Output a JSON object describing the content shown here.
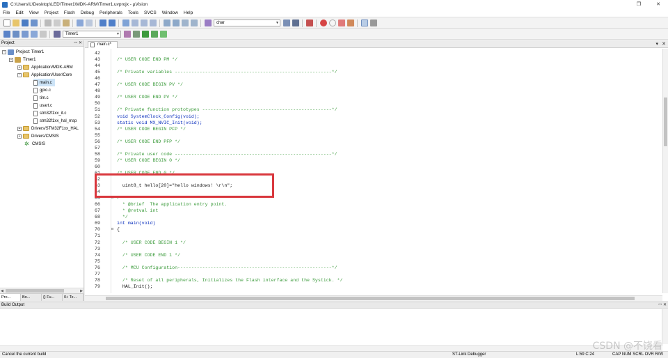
{
  "window": {
    "title": "C:\\Users\\L\\Desktop\\LED\\Timer1\\MDK-ARM\\Timer1.uvprojx - µVision"
  },
  "menu": [
    "File",
    "Edit",
    "View",
    "Project",
    "Flash",
    "Debug",
    "Peripherals",
    "Tools",
    "SVCS",
    "Window",
    "Help"
  ],
  "toolbar": {
    "search_value": "char",
    "target_value": "Timer1"
  },
  "project_panel": {
    "title": "Project",
    "root": "Project: Timer1",
    "target": "Timer1",
    "groups": [
      {
        "label": "Application/MDK-ARM",
        "expanded": false
      },
      {
        "label": "Application/User/Core",
        "expanded": true,
        "files": [
          "main.c",
          "gpio.c",
          "tim.c",
          "usart.c",
          "stm32f1xx_it.c",
          "stm32f1xx_hal_msp"
        ]
      },
      {
        "label": "Drivers/STM32F1xx_HAL",
        "expanded": false
      },
      {
        "label": "Drivers/CMSIS",
        "expanded": false
      }
    ],
    "cmsis": "CMSIS",
    "tabs": [
      "Pro...",
      "Bo...",
      "{} Fu...",
      "0+ Te..."
    ]
  },
  "editor": {
    "tab": "main.c*",
    "lines": [
      {
        "n": "42",
        "t": "",
        "c": "cm"
      },
      {
        "n": "43",
        "t": "/* USER CODE END PM */",
        "c": "cm"
      },
      {
        "n": "44",
        "t": "",
        "c": "cm"
      },
      {
        "n": "45",
        "t": "/* Private variables ---------------------------------------------------------*/",
        "c": "cm"
      },
      {
        "n": "46",
        "t": "",
        "c": "cm"
      },
      {
        "n": "47",
        "t": "/* USER CODE BEGIN PV */",
        "c": "cm"
      },
      {
        "n": "48",
        "t": "",
        "c": "cm"
      },
      {
        "n": "49",
        "t": "/* USER CODE END PV */",
        "c": "cm"
      },
      {
        "n": "50",
        "t": "",
        "c": "cm"
      },
      {
        "n": "51",
        "t": "/* Private function prototypes -----------------------------------------------*/",
        "c": "cm"
      },
      {
        "n": "52",
        "t": "void SystemClock_Config(void);",
        "c": "kw"
      },
      {
        "n": "53",
        "t": "static void MX_NVIC_Init(void);",
        "c": "kw"
      },
      {
        "n": "54",
        "t": "/* USER CODE BEGIN PFP */",
        "c": "cm"
      },
      {
        "n": "55",
        "t": "",
        "c": "cm"
      },
      {
        "n": "56",
        "t": "/* USER CODE END PFP */",
        "c": "cm"
      },
      {
        "n": "57",
        "t": "",
        "c": "cm"
      },
      {
        "n": "58",
        "t": "/* Private user code ---------------------------------------------------------*/",
        "c": "cm"
      },
      {
        "n": "59",
        "t": "/* USER CODE BEGIN 0 */",
        "c": "cm"
      },
      {
        "n": "60",
        "t": "",
        "c": "cm"
      },
      {
        "n": "61",
        "t": "/* USER CODE END 0 */",
        "c": "cm"
      },
      {
        "n": "62",
        "t": "",
        "c": "cm"
      },
      {
        "n": "63",
        "t": "  uint8_t hello[20]=\"hello windows! \\r\\n\";",
        "c": "tx"
      },
      {
        "n": "64",
        "t": "",
        "c": "cm"
      },
      {
        "n": "65",
        "t": "/**",
        "c": "cm"
      },
      {
        "n": "66",
        "t": "  * @brief  The application entry point.",
        "c": "cm"
      },
      {
        "n": "67",
        "t": "  * @retval int",
        "c": "cm"
      },
      {
        "n": "68",
        "t": "  */",
        "c": "cm"
      },
      {
        "n": "69",
        "t": "int main(void)",
        "c": "kw"
      },
      {
        "n": "70",
        "t": "{",
        "c": "tx"
      },
      {
        "n": "71",
        "t": "",
        "c": "cm"
      },
      {
        "n": "72",
        "t": "  /* USER CODE BEGIN 1 */",
        "c": "cm"
      },
      {
        "n": "73",
        "t": "",
        "c": "cm"
      },
      {
        "n": "74",
        "t": "  /* USER CODE END 1 */",
        "c": "cm"
      },
      {
        "n": "75",
        "t": "",
        "c": "cm"
      },
      {
        "n": "76",
        "t": "  /* MCU Configuration--------------------------------------------------------*/",
        "c": "cm"
      },
      {
        "n": "77",
        "t": "",
        "c": "cm"
      },
      {
        "n": "78",
        "t": "  /* Reset of all peripherals, Initializes the Flash interface and the Systick. */",
        "c": "cm"
      },
      {
        "n": "79",
        "t": "  HAL_Init();",
        "c": "tx"
      }
    ],
    "fold_marks": {
      "65": "⊟",
      "70": "⊟"
    }
  },
  "build_output": {
    "title": "Build Output"
  },
  "status": {
    "message": "Cancel the current build",
    "debugger": "ST-Link Debugger",
    "position": "L:59 C:24",
    "flags": "CAP  NUM  SCRL  OVR  R/W"
  },
  "watermark": "CSDN @不饶看",
  "colors": {
    "highlight": "#d9373d",
    "comment": "#3a9a3a",
    "keyword": "#0a2fbd"
  }
}
